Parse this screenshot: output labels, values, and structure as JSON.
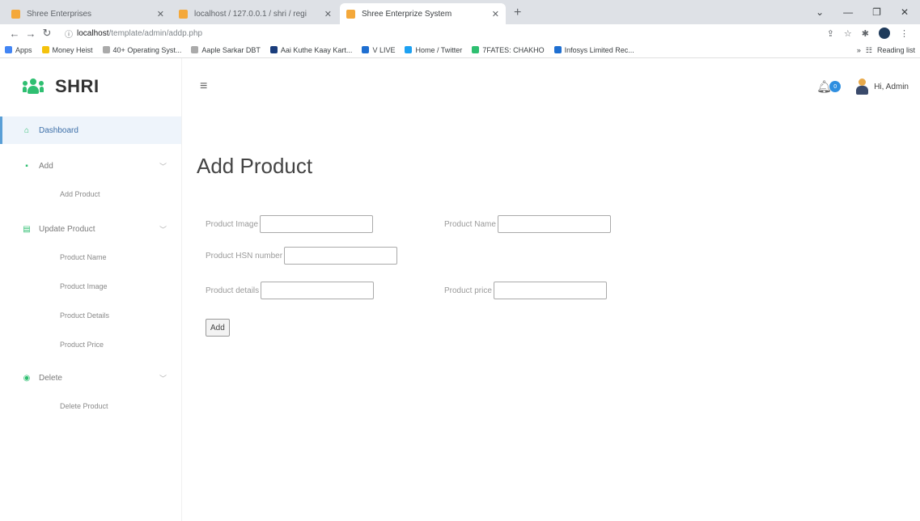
{
  "browser": {
    "tabs": [
      {
        "title": "Shree Enterprises",
        "color": "#f4a83a",
        "active": false
      },
      {
        "title": "localhost / 127.0.0.1 / shri / regi",
        "color": "#f4a83a",
        "active": false
      },
      {
        "title": "Shree Enterprize System",
        "color": "#f4a83a",
        "active": true
      }
    ],
    "url_host": "localhost",
    "url_path": "/template/admin/addp.php",
    "bookmarks": [
      {
        "label": "Apps",
        "color": "#4285f4"
      },
      {
        "label": "Money Heist",
        "color": "#f4c20d"
      },
      {
        "label": "40+ Operating Syst...",
        "color": "#aaaaaa"
      },
      {
        "label": "Aaple Sarkar DBT",
        "color": "#aaaaaa"
      },
      {
        "label": "Aai Kuthe Kaay Kart...",
        "color": "#1a3d7c"
      },
      {
        "label": "V LIVE",
        "color": "#1f6fd1"
      },
      {
        "label": "Home / Twitter",
        "color": "#1da1f2"
      },
      {
        "label": "7FATES: CHAKHO",
        "color": "#2fbf71"
      },
      {
        "label": "Infosys Limited Rec...",
        "color": "#1f6fd1"
      }
    ],
    "reading_list": "Reading list"
  },
  "sidebar": {
    "brand": "SHRI",
    "dashboard": "Dashboard",
    "add": "Add",
    "add_product": "Add Product",
    "update_product": "Update Product",
    "update_items": [
      "Product Name",
      "Product Image",
      "Product Details",
      "Product Price"
    ],
    "delete": "Delete",
    "delete_product": "Delete Product"
  },
  "topbar": {
    "notification_count": "0",
    "user": "Hi, Admin"
  },
  "form": {
    "title": "Add Product",
    "product_image_label": "Product Image",
    "product_name_label": "Product Name",
    "hsn_label": "Product HSN number",
    "details_label": "Product details",
    "price_label": "Product price",
    "submit": "Add"
  },
  "colors": {
    "accent_green": "#2fbf71",
    "accent_blue": "#5a9fd6",
    "badge_blue": "#2f8fe0"
  }
}
